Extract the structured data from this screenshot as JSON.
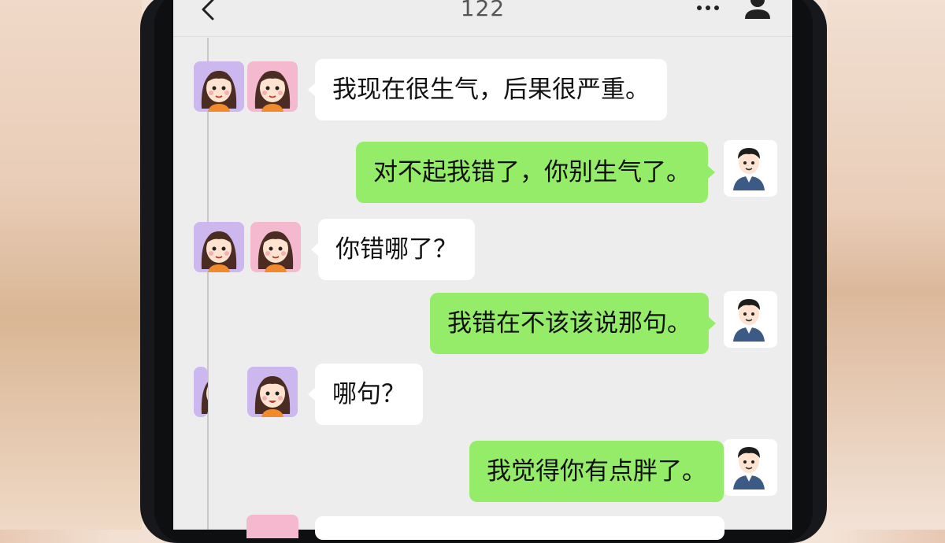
{
  "header": {
    "title": "122",
    "back_icon": "chevron-left-icon",
    "more_icon": "more-dots-icon",
    "profile_icon": "person-icon"
  },
  "colors": {
    "screen_bg": "#ededed",
    "sent_bubble": "#95ec69",
    "received_bubble": "#ffffff",
    "text": "#111111"
  },
  "messages": [
    {
      "side": "left",
      "text": "我现在很生气，后果很严重。"
    },
    {
      "side": "right",
      "text": "对不起我错了，你别生气了。"
    },
    {
      "side": "left",
      "text": "你错哪了？"
    },
    {
      "side": "right",
      "text": "我错在不该该说那句。"
    },
    {
      "side": "left",
      "text": "哪句？"
    },
    {
      "side": "right",
      "text": "我觉得你有点胖了。"
    }
  ]
}
